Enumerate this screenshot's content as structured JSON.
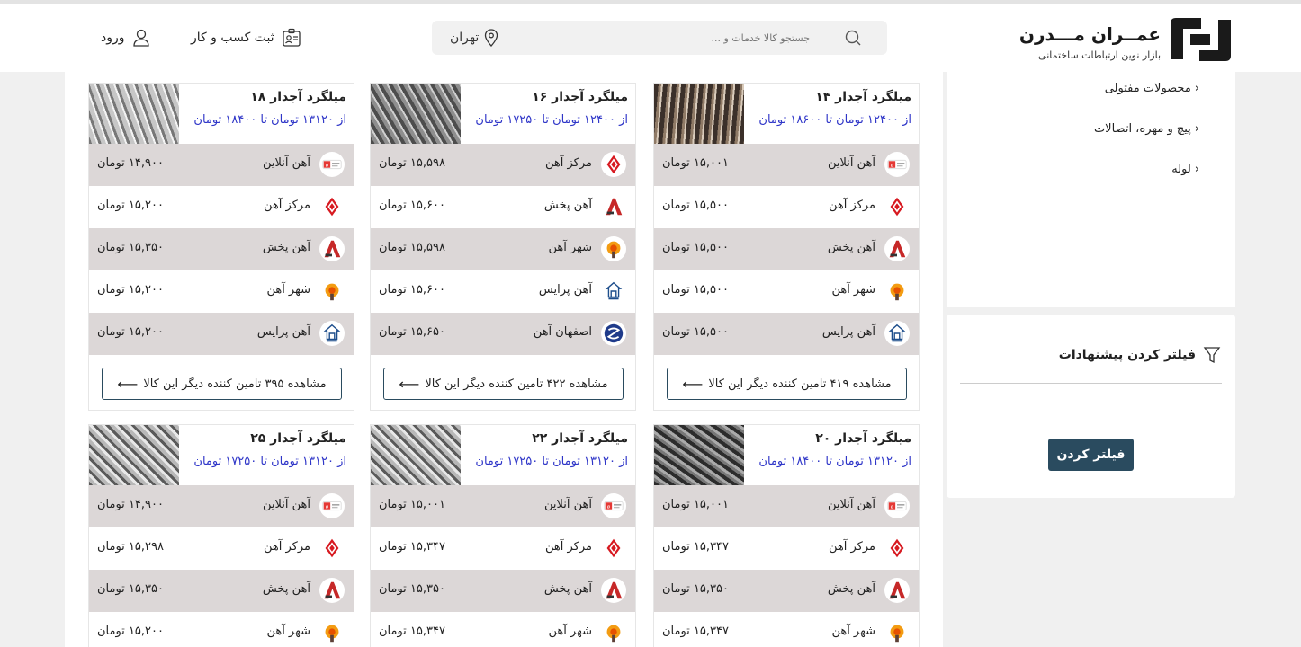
{
  "header": {
    "logo_title": "عمــران مـــدرن",
    "logo_subtitle": "بازار نوین ارتباطات ساختمانی",
    "search_placeholder": "جستجو کالا خدمات و ...",
    "location": "تهران",
    "register_label": "ثبت کسب و کار",
    "login_label": "ورود"
  },
  "sidebar": {
    "categories": [
      "محصولات مفتولی",
      "پیچ و مهره، اتصالات",
      "لوله"
    ],
    "filter_title": "فیلتر کردن پیشنهادات",
    "filter_button": "فیلتر کردن"
  },
  "products": [
    {
      "title": "میلگرد آجدار ۱۴",
      "range": "از ۱۲۴۰۰ تومان تا ۱۸۶۰۰ تومان",
      "more": "مشاهده ۴۱۹ تامین کننده دیگر این کالا",
      "suppliers": [
        {
          "name": "آهن آنلاین",
          "price": "۱۵,۰۰۱ تومان",
          "logo": "ahan-online"
        },
        {
          "name": "مرکز آهن",
          "price": "۱۵,۵۰۰ تومان",
          "logo": "markaz-ahan"
        },
        {
          "name": "آهن پخش",
          "price": "۱۵,۵۰۰ تومان",
          "logo": "ahan-pakhsh"
        },
        {
          "name": "شهر آهن",
          "price": "۱۵,۵۰۰ تومان",
          "logo": "shahr-ahan"
        },
        {
          "name": "آهن پرایس",
          "price": "۱۵,۵۰۰ تومان",
          "logo": "ahan-price"
        }
      ]
    },
    {
      "title": "میلگرد آجدار ۱۶",
      "range": "از ۱۲۴۰۰ تومان تا ۱۷۲۵۰ تومان",
      "more": "مشاهده ۴۲۲ تامین کننده دیگر این کالا",
      "suppliers": [
        {
          "name": "مرکز آهن",
          "price": "۱۵,۵۹۸ تومان",
          "logo": "markaz-ahan"
        },
        {
          "name": "آهن پخش",
          "price": "۱۵,۶۰۰ تومان",
          "logo": "ahan-pakhsh"
        },
        {
          "name": "شهر آهن",
          "price": "۱۵,۵۹۸ تومان",
          "logo": "shahr-ahan"
        },
        {
          "name": "آهن پرایس",
          "price": "۱۵,۶۰۰ تومان",
          "logo": "ahan-price"
        },
        {
          "name": "اصفهان آهن",
          "price": "۱۵,۶۵۰ تومان",
          "logo": "esfahan-ahan"
        }
      ]
    },
    {
      "title": "میلگرد آجدار ۱۸",
      "range": "از ۱۳۱۲۰ تومان تا ۱۸۴۰۰ تومان",
      "more": "مشاهده ۳۹۵ تامین کننده دیگر این کالا",
      "suppliers": [
        {
          "name": "آهن آنلاین",
          "price": "۱۴,۹۰۰ تومان",
          "logo": "ahan-online"
        },
        {
          "name": "مرکز آهن",
          "price": "۱۵,۲۰۰ تومان",
          "logo": "markaz-ahan"
        },
        {
          "name": "آهن پخش",
          "price": "۱۵,۳۵۰ تومان",
          "logo": "ahan-pakhsh"
        },
        {
          "name": "شهر آهن",
          "price": "۱۵,۲۰۰ تومان",
          "logo": "shahr-ahan"
        },
        {
          "name": "آهن پرایس",
          "price": "۱۵,۲۰۰ تومان",
          "logo": "ahan-price"
        }
      ]
    },
    {
      "title": "میلگرد آجدار ۲۰",
      "range": "از ۱۳۱۲۰ تومان تا ۱۸۴۰۰ تومان",
      "suppliers": [
        {
          "name": "آهن آنلاین",
          "price": "۱۵,۰۰۱ تومان",
          "logo": "ahan-online"
        },
        {
          "name": "مرکز آهن",
          "price": "۱۵,۳۴۷ تومان",
          "logo": "markaz-ahan"
        },
        {
          "name": "آهن پخش",
          "price": "۱۵,۳۵۰ تومان",
          "logo": "ahan-pakhsh"
        },
        {
          "name": "شهر آهن",
          "price": "۱۵,۳۴۷ تومان",
          "logo": "shahr-ahan"
        }
      ]
    },
    {
      "title": "میلگرد آجدار ۲۲",
      "range": "از ۱۳۱۲۰ تومان تا ۱۷۲۵۰ تومان",
      "suppliers": [
        {
          "name": "آهن آنلاین",
          "price": "۱۵,۰۰۱ تومان",
          "logo": "ahan-online"
        },
        {
          "name": "مرکز آهن",
          "price": "۱۵,۳۴۷ تومان",
          "logo": "markaz-ahan"
        },
        {
          "name": "آهن پخش",
          "price": "۱۵,۳۵۰ تومان",
          "logo": "ahan-pakhsh"
        },
        {
          "name": "شهر آهن",
          "price": "۱۵,۳۴۷ تومان",
          "logo": "shahr-ahan"
        }
      ]
    },
    {
      "title": "میلگرد آجدار ۲۵",
      "range": "از ۱۳۱۲۰ تومان تا ۱۷۲۵۰ تومان",
      "suppliers": [
        {
          "name": "آهن آنلاین",
          "price": "۱۴,۹۰۰ تومان",
          "logo": "ahan-online"
        },
        {
          "name": "مرکز آهن",
          "price": "۱۵,۲۹۸ تومان",
          "logo": "markaz-ahan"
        },
        {
          "name": "آهن پخش",
          "price": "۱۵,۳۵۰ تومان",
          "logo": "ahan-pakhsh"
        },
        {
          "name": "شهر آهن",
          "price": "۱۵,۲۰۰ تومان",
          "logo": "shahr-ahan"
        }
      ]
    }
  ]
}
